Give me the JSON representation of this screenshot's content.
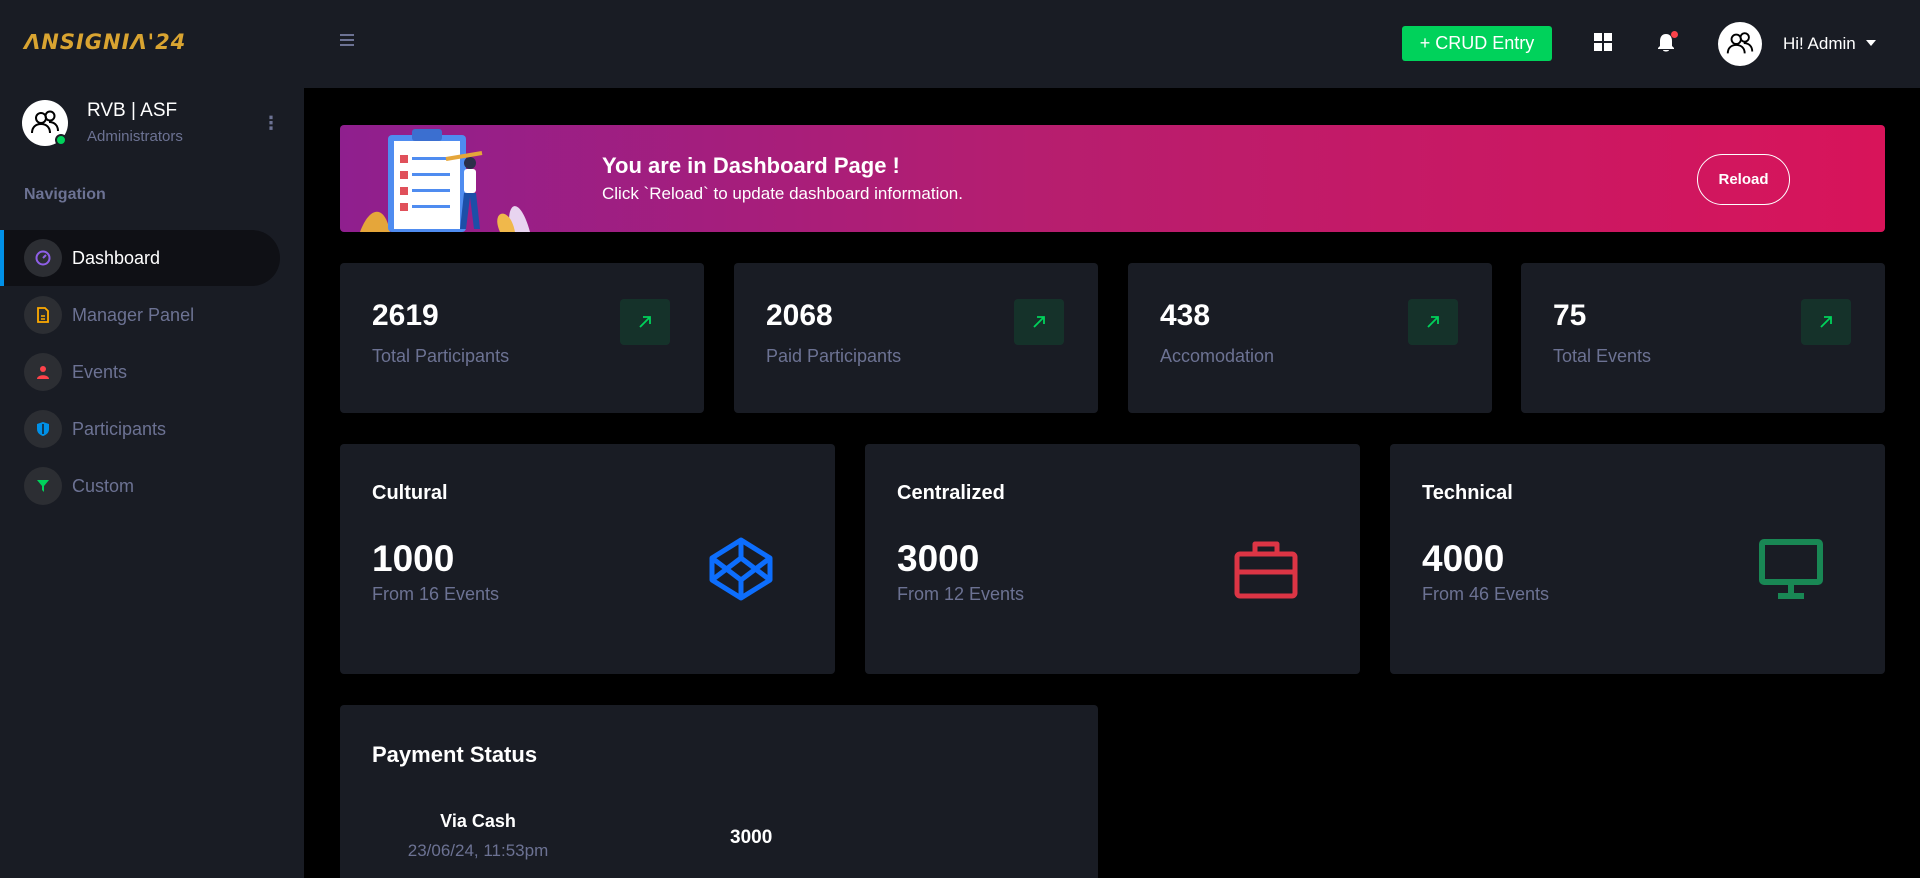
{
  "brand": {
    "name": "ᐱNSIGNIᐱ'24",
    "color": "#d9a431"
  },
  "profile": {
    "name": "RVB | ASF",
    "role": "Administrators",
    "status": "online"
  },
  "nav": {
    "heading": "Navigation",
    "items": [
      {
        "label": "Dashboard",
        "icon": "speedometer-icon",
        "icon_color": "#8f5fe8",
        "active": true
      },
      {
        "label": "Manager Panel",
        "icon": "file-icon",
        "icon_color": "#ffab00",
        "active": false
      },
      {
        "label": "Events",
        "icon": "person-icon",
        "icon_color": "#fc424a",
        "active": false
      },
      {
        "label": "Participants",
        "icon": "shield-icon",
        "icon_color": "#0090e7",
        "active": false
      },
      {
        "label": "Custom",
        "icon": "filter-icon",
        "icon_color": "#00d25b",
        "active": false
      }
    ]
  },
  "topbar": {
    "crud_label": "+ CRUD Entry",
    "user_greeting": "Hi! Admin",
    "accent": "#00d25b"
  },
  "banner": {
    "title": "You are in Dashboard Page !",
    "subtitle": "Click `Reload` to update dashboard information.",
    "reload_label": "Reload"
  },
  "stats": [
    {
      "value": "2619",
      "label": "Total Participants"
    },
    {
      "value": "2068",
      "label": "Paid Participants"
    },
    {
      "value": "438",
      "label": "Accomodation"
    },
    {
      "value": "75",
      "label": "Total Events"
    }
  ],
  "categories": [
    {
      "title": "Cultural",
      "value": "1000",
      "sub": "From 16 Events",
      "icon": "codepen-icon",
      "color": "#0d6efd"
    },
    {
      "title": "Centralized",
      "value": "3000",
      "sub": "From 12 Events",
      "icon": "briefcase-icon",
      "color": "#dc3545"
    },
    {
      "title": "Technical",
      "value": "4000",
      "sub": "From 46 Events",
      "icon": "monitor-icon",
      "color": "#198754"
    }
  ],
  "payment": {
    "title": "Payment Status",
    "rows": [
      {
        "method": "Via Cash",
        "date": "23/06/24, 11:53pm",
        "amount": "3000"
      }
    ]
  }
}
